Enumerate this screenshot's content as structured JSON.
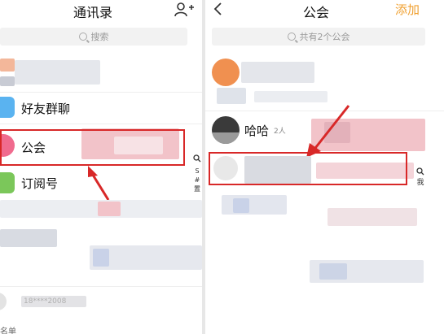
{
  "left_panel": {
    "title": "通讯录",
    "search_placeholder": "搜索",
    "items": [
      {
        "label": "好友群聊"
      },
      {
        "label": "公会"
      },
      {
        "label": "订阅号"
      }
    ],
    "index_bar": [
      "S",
      "#",
      "置"
    ],
    "section_footer": "名单",
    "blurred_number": "18****2008"
  },
  "right_panel": {
    "title": "公会",
    "add_label": "添加",
    "search_placeholder": "共有2个公会",
    "guilds": [
      {
        "name": "哈哈",
        "members": "2人"
      }
    ],
    "index_bar": [
      "我"
    ]
  },
  "colors": {
    "accent": "#f0a030",
    "highlight": "#d82828",
    "blur_pink": "#f2c3c9"
  },
  "icons": {
    "add_friend": "person-plus-icon",
    "back": "chevron-left-icon",
    "search": "search-icon"
  }
}
